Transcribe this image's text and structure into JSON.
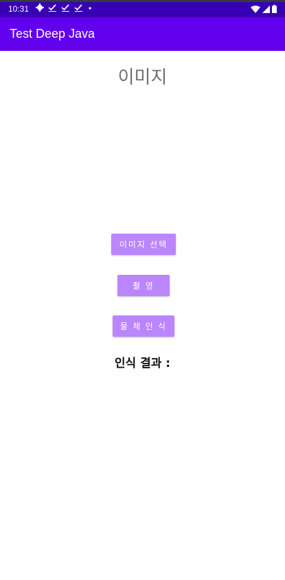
{
  "status_bar": {
    "time": "10:31",
    "left_icons": [
      "gear-icon",
      "check-icon",
      "check-icon",
      "check-icon",
      "dot-icon"
    ],
    "right_icons": [
      "wifi-icon",
      "signal-icon",
      "battery-icon"
    ],
    "bg_color": "#3700b3"
  },
  "app_bar": {
    "title": "Test Deep Java",
    "bg_color": "#6200ee"
  },
  "main": {
    "image_title": "이미지",
    "buttons": {
      "select_image": "이미지 선택",
      "capture": "촬 영",
      "detect": "물 체 인 식"
    },
    "result_label": "인식 결과 :"
  },
  "colors": {
    "button": "#bb86fc",
    "title_text": "#6f6f6f"
  }
}
